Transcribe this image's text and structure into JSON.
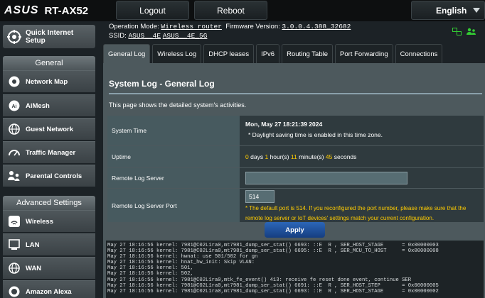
{
  "brand": {
    "name": "ASUS",
    "model": "RT-AX52"
  },
  "topbar": {
    "logout": "Logout",
    "reboot": "Reboot",
    "language": "English"
  },
  "header": {
    "op_mode_label": "Operation Mode:",
    "op_mode_value": "Wireless router",
    "fw_label": "Firmware Version:",
    "fw_value": "3.0.0.4.388_32682",
    "ssid_label": "SSID:",
    "ssid_1": "ASUS__4E",
    "ssid_2": "ASUS__4E_5G"
  },
  "sidebar": {
    "quick_setup": "Quick Internet Setup",
    "general_header": "General",
    "general_items": [
      {
        "label": "Network Map",
        "icon": "network-map-icon"
      },
      {
        "label": "AiMesh",
        "icon": "aimesh-icon"
      },
      {
        "label": "Guest Network",
        "icon": "globe-icon"
      },
      {
        "label": "Traffic Manager",
        "icon": "gauge-icon"
      },
      {
        "label": "Parental Controls",
        "icon": "parental-icon"
      }
    ],
    "advanced_header": "Advanced Settings",
    "advanced_items": [
      {
        "label": "Wireless",
        "icon": "wifi-icon"
      },
      {
        "label": "LAN",
        "icon": "lan-icon"
      },
      {
        "label": "WAN",
        "icon": "globe-icon"
      },
      {
        "label": "Amazon Alexa",
        "icon": "alexa-icon"
      }
    ]
  },
  "tabs": [
    "General Log",
    "Wireless Log",
    "DHCP leases",
    "IPv6",
    "Routing Table",
    "Port Forwarding",
    "Connections"
  ],
  "panel": {
    "title": "System Log - General Log",
    "description": "This page shows the detailed system's activities.",
    "system_time_label": "System Time",
    "system_time_value": "Mon, May 27 18:21:39 2024",
    "system_time_note": "* Daylight saving time is enabled in this time zone.",
    "uptime_label": "Uptime",
    "uptime": {
      "days": "0",
      "days_unit": "days",
      "hours": "1",
      "hours_unit": "hour(s)",
      "minutes": "11",
      "minutes_unit": "minute(s)",
      "seconds": "45",
      "seconds_unit": "seconds"
    },
    "remote_server_label": "Remote Log Server",
    "remote_server_value": "",
    "remote_port_label": "Remote Log Server Port",
    "remote_port_value": "514",
    "remote_port_note_1": "* The default port is 514. If you reconfigured the port number, please make sure that the",
    "remote_port_note_2": "remote log server or IoT devices' settings match your current configuration.",
    "apply": "Apply"
  },
  "log_lines": [
    "May 27 18:16:56 kernel: 7981@C02L1ra0,mt7981_dump_ser_stat() 6693: ::E  R , SER_HOST_STAGE      = 0x00000003",
    "May 27 18:16:56 kernel: 7981@C02L1ra0,mt7981_dump_ser_stat() 6695: ::E  R , SER_MCU_TO_HOST     = 0x00000008",
    "May 27 18:16:56 kernel: hwnat: use 501/502 for gn",
    "May 27 18:16:56 kernel: hnat_hw_init: Skip VLAN:",
    "May 27 18:16:56 kernel: 501,",
    "May 27 18:16:56 kernel: 502,",
    "May 27 18:16:56 kernel: 7981@C02L1ra0,mtk_fe_event() 413: receive fe reset done event, continue SER",
    "May 27 18:16:56 kernel: 7981@C02L1ra0,mt7981_dump_ser_stat() 6691: ::E  R , SER_HOST_STEP       = 0x00000005",
    "May 27 18:16:56 kernel: 7981@C02L1ra0,mt7981_dump_ser_stat() 6693: ::E  R , SER_HOST_STAGE      = 0x00000002"
  ]
}
